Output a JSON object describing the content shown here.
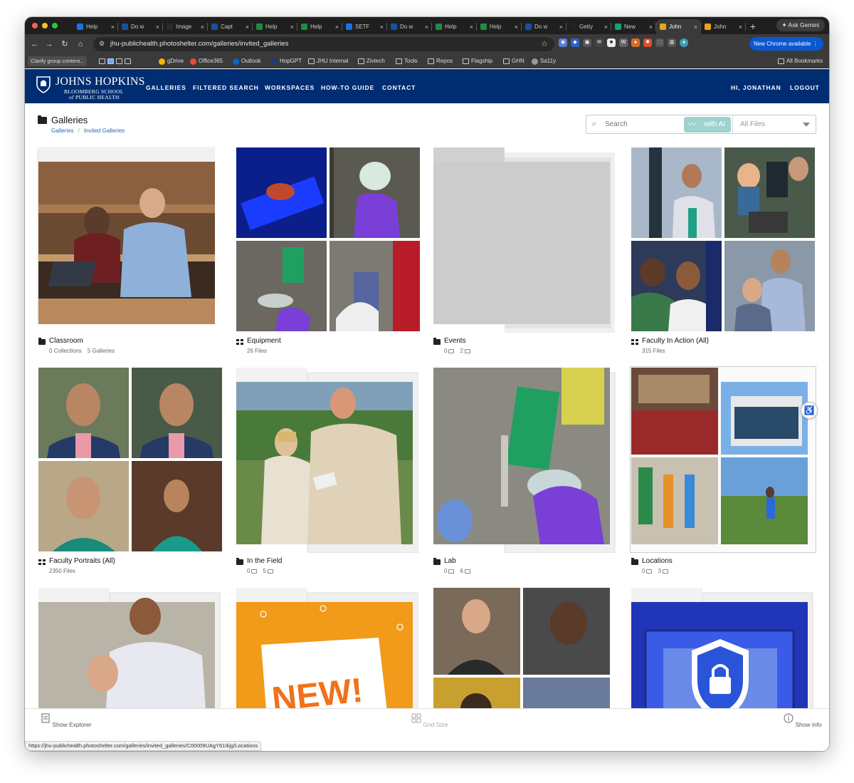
{
  "browser": {
    "tabs": [
      {
        "label": "Help",
        "color": "#1a73e8"
      },
      {
        "label": "Do w",
        "color": "#1a4fa0"
      },
      {
        "label": "Image",
        "color": "#2b2b2b"
      },
      {
        "label": "Capt",
        "color": "#1a4fa0"
      },
      {
        "label": "Help",
        "color": "#1e8e3e"
      },
      {
        "label": "Help",
        "color": "#1e8e3e"
      },
      {
        "label": "SETF",
        "color": "#1a73e8"
      },
      {
        "label": "Do w",
        "color": "#1a4fa0"
      },
      {
        "label": "Help",
        "color": "#1e8e3e"
      },
      {
        "label": "Help",
        "color": "#1e8e3e"
      },
      {
        "label": "Do w",
        "color": "#1a4fa0"
      },
      {
        "label": "Getty",
        "color": "#222222"
      },
      {
        "label": "New",
        "color": "#10a37f"
      },
      {
        "label": "John",
        "color": "#e8a317"
      },
      {
        "label": "John",
        "color": "#e8a317"
      }
    ],
    "active_tab_index": 13,
    "ask_gemini": "Ask Gemini",
    "url": "jhu-publichealth.photoshelter.com/galleries/invited_galleries",
    "chrome_update": "New Chrome available",
    "bookmarks": {
      "clarify": "Clarify group content...",
      "items": [
        "gDrive",
        "Office365",
        "Outlook",
        "HopGPT",
        "JHU Internal",
        "Zivtech",
        "Tools",
        "Repos",
        "Flagship",
        "GHN",
        "Sa11y"
      ],
      "all_bookmarks": "All Bookmarks"
    },
    "status_url": "https://jhu-publichealth.photoshelter.com/galleries/invited_galleries/C00009UAgY61Ikjg/Locations"
  },
  "site": {
    "logo": {
      "main": "JOHNS HOPKINS",
      "sub1": "BLOOMBERG SCHOOL",
      "sub2": "of PUBLIC HEALTH"
    },
    "nav": [
      "GALLERIES",
      "FILTERED SEARCH",
      "WORKSPACES",
      "HOW-TO GUIDE",
      "CONTACT"
    ],
    "user_greeting": "HI, JONATHAN",
    "logout": "LOGOUT",
    "brand_color": "#002d72"
  },
  "page": {
    "title": "Galleries",
    "breadcrumbs": [
      "Galleries",
      "Invited Galleries"
    ],
    "search_placeholder": "Search",
    "with_ai": "with AI",
    "filter_selected": "All Files"
  },
  "galleries": [
    {
      "name": "Classroom",
      "type": "folder",
      "meta_a": "0 Collections",
      "meta_b": "5 Galleries"
    },
    {
      "name": "Equipment",
      "type": "grid",
      "meta_a": "26 Files",
      "meta_b": ""
    },
    {
      "name": "Events",
      "type": "folder",
      "meta_a": "0",
      "meta_b": "2"
    },
    {
      "name": "Faculty In Action (All)",
      "type": "grid",
      "meta_a": "315 Files",
      "meta_b": ""
    },
    {
      "name": "Faculty Portraits (All)",
      "type": "grid",
      "meta_a": "2350 Files",
      "meta_b": ""
    },
    {
      "name": "In the Field",
      "type": "folder",
      "meta_a": "0",
      "meta_b": "5"
    },
    {
      "name": "Lab",
      "type": "folder",
      "meta_a": "0",
      "meta_b": "6"
    },
    {
      "name": "Locations",
      "type": "folder",
      "meta_a": "0",
      "meta_b": "3"
    },
    {
      "name": "",
      "type": "folder",
      "meta_a": "",
      "meta_b": ""
    },
    {
      "name": "",
      "type": "folder",
      "meta_a": "",
      "meta_b": ""
    },
    {
      "name": "",
      "type": "folder",
      "meta_a": "",
      "meta_b": ""
    },
    {
      "name": "",
      "type": "folder",
      "meta_a": "",
      "meta_b": ""
    }
  ],
  "new_badge": "NEW!",
  "bottom_bar": {
    "show_explorer": "Show Explorer",
    "grid_size": "Grid Size",
    "show_info": "Show info"
  }
}
